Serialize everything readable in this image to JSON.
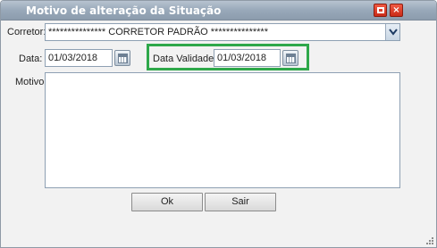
{
  "window": {
    "title": "Motivo de alteração da Situação",
    "maximize_icon": "maximize-icon",
    "close_icon": "close-icon",
    "close_glyph": "×"
  },
  "form": {
    "corretor_label": "Corretor:",
    "corretor_value": "*************** CORRETOR PADRÃO ***************",
    "data_label": "Data:",
    "data_value": "01/03/2018",
    "data_validade_label": "Data Validade:",
    "data_validade_value": "01/03/2018",
    "motivo_label": "Motivo:",
    "motivo_value": ""
  },
  "buttons": {
    "ok_label": "Ok",
    "sair_label": "Sair"
  },
  "colors": {
    "titlebar": "#98a8b9",
    "title_button": "#d93a24",
    "highlight": "#2ea84a"
  }
}
